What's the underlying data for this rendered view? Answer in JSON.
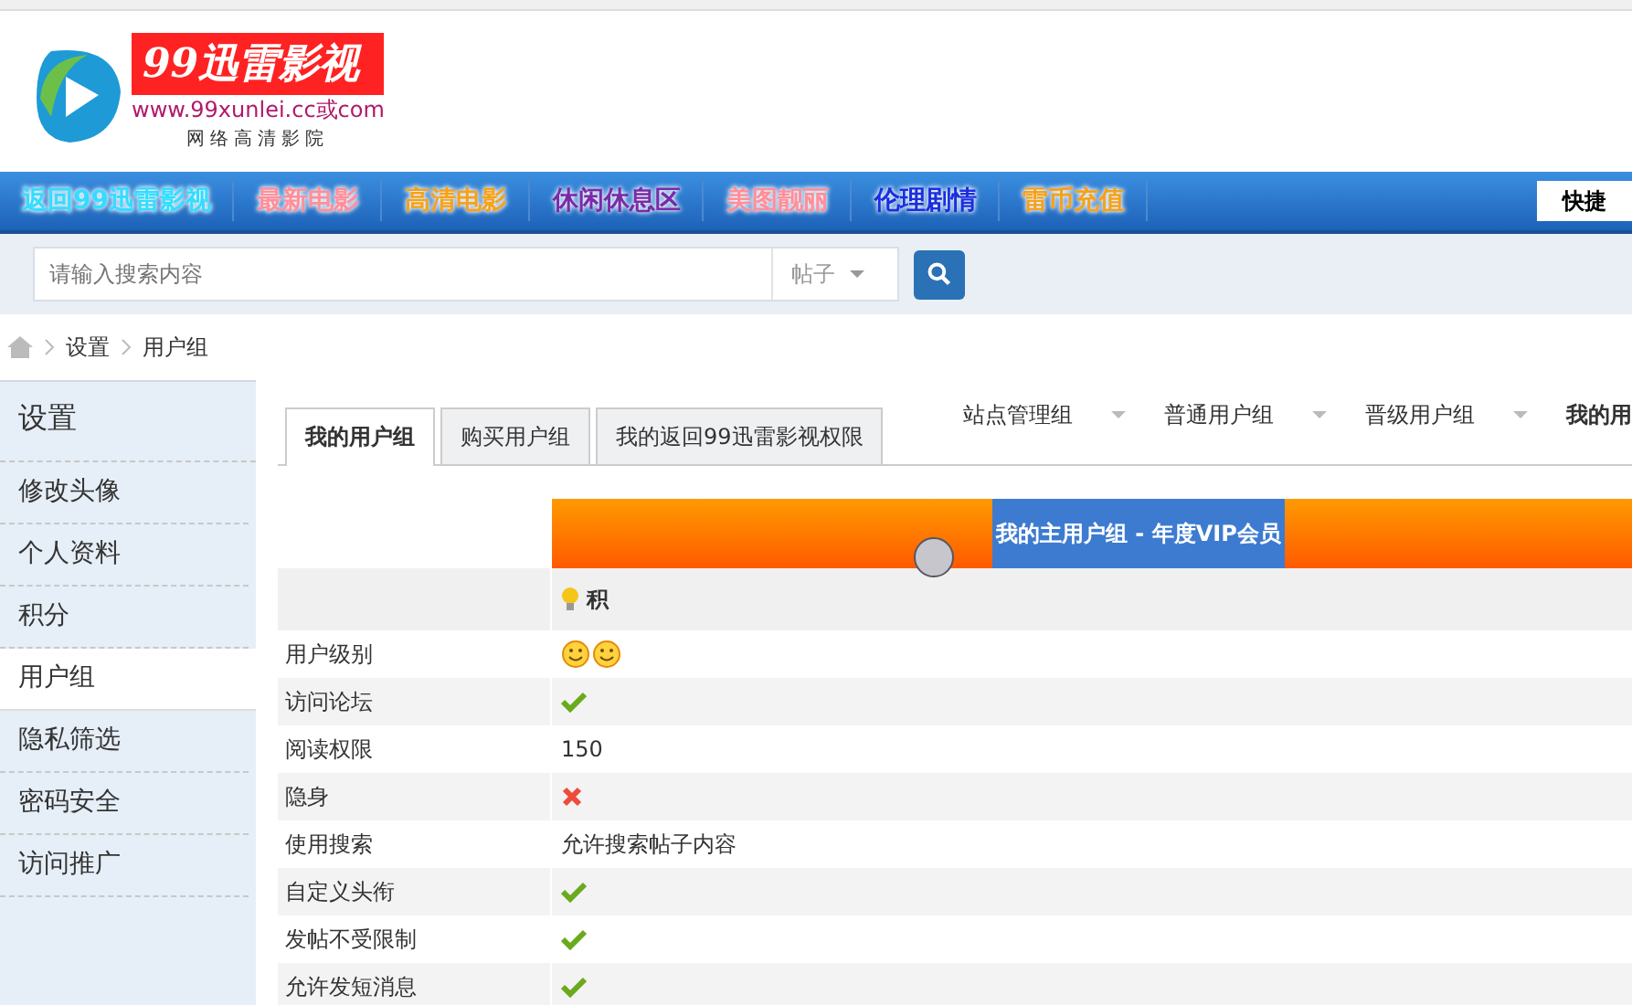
{
  "logo": {
    "title": "99迅雷影视",
    "url": "www.99xunlei.cc或com",
    "slogan": "网络高清影院"
  },
  "nav": [
    {
      "label": "返回99迅雷影视",
      "color": "#33ddff"
    },
    {
      "label": "最新电影",
      "color": "#ff8f9a"
    },
    {
      "label": "高清电影",
      "color": "#f5a21b"
    },
    {
      "label": "休闲休息区",
      "color": "#7a2aa8"
    },
    {
      "label": "美图靓丽",
      "color": "#ff8f9a"
    },
    {
      "label": "伦理剧情",
      "color": "#1a2ee0"
    },
    {
      "label": "雷币充值",
      "color": "#f5a21b"
    }
  ],
  "nav_button": "快捷",
  "search": {
    "placeholder": "请输入搜索内容",
    "scope": "帖子"
  },
  "breadcrumb": [
    "设置",
    "用户组"
  ],
  "sidebar": {
    "title": "设置",
    "items": [
      {
        "label": "修改头像",
        "selected": false
      },
      {
        "label": "个人资料",
        "selected": false
      },
      {
        "label": "积分",
        "selected": false
      },
      {
        "label": "用户组",
        "selected": true
      },
      {
        "label": "隐私筛选",
        "selected": false
      },
      {
        "label": "密码安全",
        "selected": false
      },
      {
        "label": "访问推广",
        "selected": false
      }
    ]
  },
  "tabs": [
    {
      "label": "我的用户组",
      "selected": true
    },
    {
      "label": "购买用户组",
      "selected": false
    },
    {
      "label": "我的返回99迅雷影视权限",
      "selected": false
    }
  ],
  "group_menus": [
    "站点管理组",
    "普通用户组",
    "晋级用户组",
    "我的用"
  ],
  "banner": "我的主用户组 - 年度VIP会员",
  "points_label": "积",
  "rows": [
    {
      "label": "用户级别",
      "kind": "icons",
      "icons": [
        {
          "kind": "smiley"
        },
        {
          "kind": "smiley"
        }
      ]
    },
    {
      "label": "访问论坛",
      "kind": "check"
    },
    {
      "label": "阅读权限",
      "kind": "text",
      "value": "150"
    },
    {
      "label": "隐身",
      "kind": "cross"
    },
    {
      "label": "使用搜索",
      "kind": "text",
      "value": "允许搜索帖子内容"
    },
    {
      "label": "自定义头衔",
      "kind": "check"
    },
    {
      "label": "发帖不受限制",
      "kind": "check"
    },
    {
      "label": "允许发短消息",
      "kind": "check"
    }
  ]
}
